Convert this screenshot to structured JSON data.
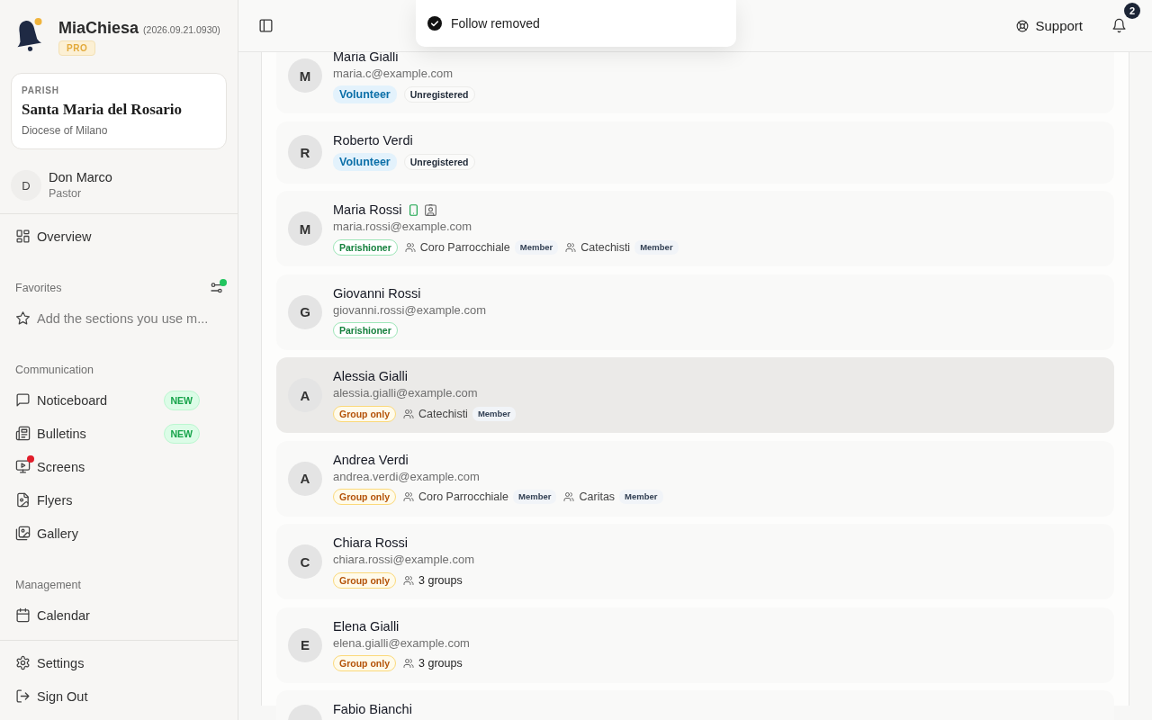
{
  "sidebar": {
    "brand": {
      "name": "MiaChiesa",
      "version": "(2026.09.21.0930)",
      "plan": "PRO"
    },
    "parish": {
      "label": "PARISH",
      "name": "Santa Maria del Rosario",
      "diocese": "Diocese of Milano"
    },
    "user": {
      "initial": "D",
      "name": "Don Marco",
      "role": "Pastor"
    },
    "nav": [
      {
        "label": "Overview"
      }
    ],
    "favorites": {
      "title": "Favorites",
      "has_update": true,
      "hint": "Add the sections you use m..."
    },
    "sections": [
      {
        "title": "Communication",
        "items": [
          {
            "label": "Noticeboard",
            "badge": "NEW",
            "alert": false
          },
          {
            "label": "Bulletins",
            "badge": "NEW",
            "alert": false
          },
          {
            "label": "Screens",
            "alert": true
          },
          {
            "label": "Flyers",
            "alert": false
          },
          {
            "label": "Gallery",
            "alert": false
          }
        ]
      },
      {
        "title": "Management",
        "items": [
          {
            "label": "Calendar",
            "alert": false
          }
        ]
      }
    ],
    "footer": [
      {
        "label": "Settings"
      },
      {
        "label": "Sign Out"
      }
    ]
  },
  "header": {
    "support": "Support",
    "notification_count": "2"
  },
  "toast": {
    "message": "Follow removed"
  },
  "people": [
    {
      "initial": "M",
      "name": "Maria Gialli",
      "email": "maria.c@example.com",
      "app": false,
      "profile": false,
      "highlighted": false,
      "tags": [
        {
          "kind": "volunteer",
          "label": "Volunteer"
        },
        {
          "kind": "unregistered",
          "label": "Unregistered"
        }
      ]
    },
    {
      "initial": "R",
      "name": "Roberto Verdi",
      "app": false,
      "profile": false,
      "highlighted": false,
      "tags": [
        {
          "kind": "volunteer",
          "label": "Volunteer"
        },
        {
          "kind": "unregistered",
          "label": "Unregistered"
        }
      ]
    },
    {
      "initial": "M",
      "name": "Maria Rossi",
      "email": "maria.rossi@example.com",
      "app": true,
      "profile": true,
      "highlighted": false,
      "tags": [
        {
          "kind": "parishioner",
          "label": "Parishioner"
        }
      ],
      "groups": [
        {
          "name": "Coro Parrocchiale",
          "role": "Member"
        },
        {
          "name": "Catechisti",
          "role": "Member"
        }
      ]
    },
    {
      "initial": "G",
      "name": "Giovanni Rossi",
      "email": "giovanni.rossi@example.com",
      "app": false,
      "profile": false,
      "highlighted": false,
      "tags": [
        {
          "kind": "parishioner",
          "label": "Parishioner"
        }
      ]
    },
    {
      "initial": "A",
      "name": "Alessia Gialli",
      "email": "alessia.gialli@example.com",
      "app": false,
      "profile": false,
      "highlighted": true,
      "tags": [
        {
          "kind": "group_only",
          "label": "Group only"
        }
      ],
      "groups": [
        {
          "name": "Catechisti",
          "role": "Member"
        }
      ]
    },
    {
      "initial": "A",
      "name": "Andrea Verdi",
      "email": "andrea.verdi@example.com",
      "app": false,
      "profile": false,
      "highlighted": false,
      "tags": [
        {
          "kind": "group_only",
          "label": "Group only"
        }
      ],
      "groups": [
        {
          "name": "Coro Parrocchiale",
          "role": "Member"
        },
        {
          "name": "Caritas",
          "role": "Member"
        }
      ]
    },
    {
      "initial": "C",
      "name": "Chiara Rossi",
      "email": "chiara.rossi@example.com",
      "app": false,
      "profile": false,
      "highlighted": false,
      "tags": [
        {
          "kind": "group_only",
          "label": "Group only"
        }
      ],
      "group_summary": "3 groups"
    },
    {
      "initial": "E",
      "name": "Elena Gialli",
      "email": "elena.gialli@example.com",
      "app": false,
      "profile": false,
      "highlighted": false,
      "tags": [
        {
          "kind": "group_only",
          "label": "Group only"
        }
      ],
      "group_summary": "3 groups"
    },
    {
      "name": "Fabio Bianchi",
      "app": false,
      "profile": false,
      "highlighted": false
    }
  ]
}
